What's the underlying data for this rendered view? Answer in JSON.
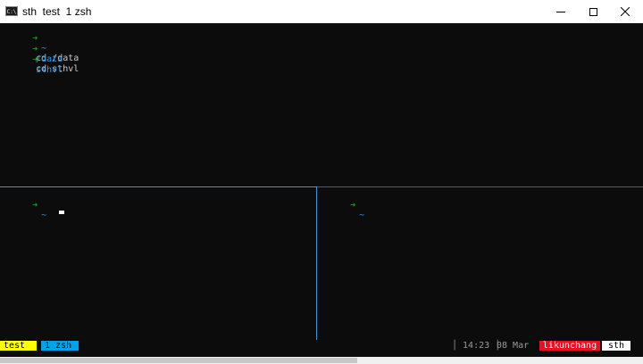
{
  "window": {
    "icon_label": "C:\\",
    "title": "sth  test  1 zsh",
    "minimize_glyph": "—",
    "maximize_glyph": "☐",
    "close_glyph": "✕"
  },
  "top_pane": {
    "lines": [
      {
        "arrow": "➜",
        "dir": "~",
        "cmd": "cd /data"
      },
      {
        "arrow": "➜",
        "dir": "/data",
        "cmd": "cd sthvl"
      },
      {
        "arrow": "➜",
        "dir": "sthvl",
        "cmd": ""
      }
    ]
  },
  "bottom_left_pane": {
    "arrow": "➜",
    "dir": "~"
  },
  "bottom_right_pane": {
    "arrow": "➜",
    "dir": "~"
  },
  "status_bar": {
    "windows": [
      {
        "label": "test",
        "color": "#ffff00"
      },
      {
        "label": "1 zsh",
        "color": "#00a2e8"
      }
    ],
    "time": "│ 14:23 │",
    "date": "08 Mar",
    "user": "likunchang",
    "host": "sth",
    "user_color": "#e81123"
  },
  "colors": {
    "terminal_bg": "#0c0c0c",
    "prompt_arrow": "#13a10e",
    "dir": "#3a96dd",
    "active_border": "#3a96dd"
  }
}
